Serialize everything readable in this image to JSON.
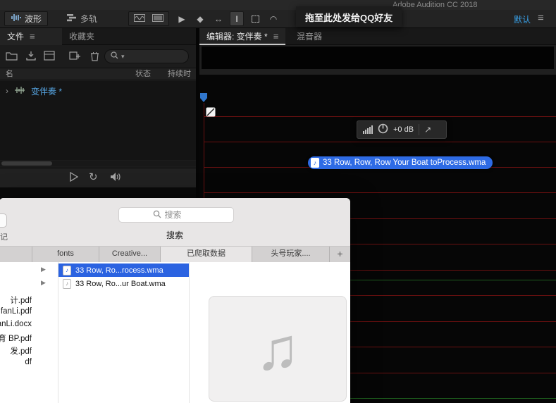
{
  "app": {
    "title": "Adobe Audition CC 2018"
  },
  "toolbar": {
    "waveform_tab": "波形",
    "multitrack_tab": "多轨",
    "workspace": "默认"
  },
  "tooltip": "拖至此处发给QQ好友",
  "files_panel": {
    "tab_files": "文件",
    "tab_favorites": "收藏夹",
    "columns": {
      "name": "名称",
      "status": "状态",
      "duration": "持续时间"
    },
    "file": {
      "name": "变伴奏 *"
    }
  },
  "editor": {
    "tab_editor": "编辑器: 变伴奏 *",
    "tab_mixer": "混音器",
    "hud_gain": "+0 dB",
    "drag_label": "33 Row, Row, Row Your Boat toProcess.wma"
  },
  "finder": {
    "search_text": "搜索",
    "title": "搜索",
    "partial_sidebar_label": "记",
    "tabs": [
      "fonts",
      "Creative...",
      "已爬取数据",
      "头号玩家....",
      "+"
    ],
    "left_files": [
      "计.pdf",
      "fanLi.pdf",
      "anLi.docx",
      "育 BP.pdf",
      "发.pdf",
      "df"
    ],
    "items": [
      {
        "name": "33 Row, Ro...rocess.wma"
      },
      {
        "name": "33 Row, Ro...ur Boat.wma"
      }
    ]
  },
  "icons": {
    "hamburger": "≡",
    "sort_asc": "↑",
    "chevron_right": "›",
    "disclosure": "▶",
    "note": "♪",
    "big_note": "♫",
    "popout": "↗",
    "loop": "↻",
    "caret_down": "▾",
    "tool_move": "▶",
    "tool_razor": "◆",
    "tool_slip": "↔",
    "tool_timesel": "I",
    "tool_lasso": "◠"
  },
  "colors": {
    "accent_blue": "#38a0e8",
    "selection_blue": "#2b63e1",
    "pill_blue": "#2e6be5",
    "grid_red": "#6b1010",
    "grid_green": "#1d5c1d",
    "file_link_blue": "#55a3e0"
  }
}
